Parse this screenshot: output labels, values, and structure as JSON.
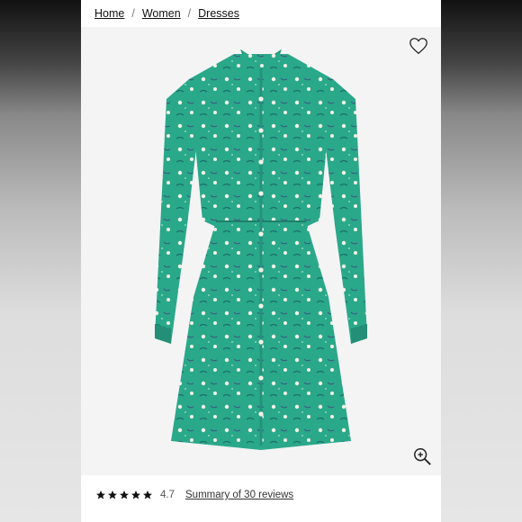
{
  "breadcrumb": {
    "items": [
      "Home",
      "Women",
      "Dresses"
    ],
    "separator": "/"
  },
  "product": {
    "image_description_icons": [
      "heart-icon",
      "zoom-in-icon"
    ],
    "dress_color": "#2aa88a",
    "rating": {
      "value": "4.7",
      "stars": 4.7,
      "reviews_link": "Summary of 30 reviews"
    }
  }
}
